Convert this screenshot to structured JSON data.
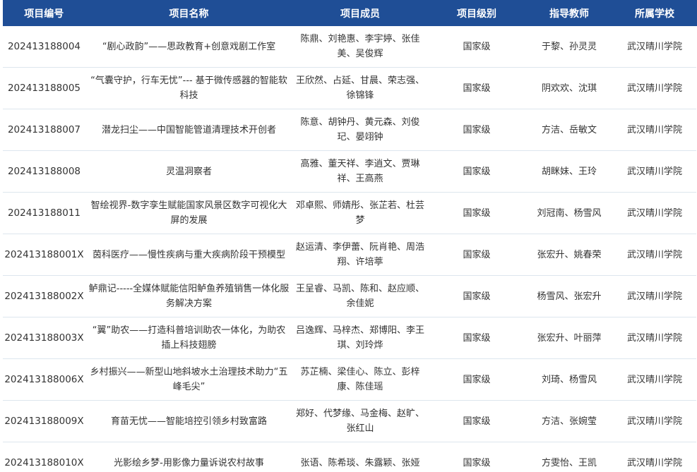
{
  "table": {
    "headers": [
      "项目编号",
      "项目名称",
      "项目成员",
      "项目级别",
      "指导教师",
      "所属学校"
    ],
    "rows": [
      {
        "id": "202413188004",
        "name": "“剧心政韵”——思政教育+创意戏剧工作室",
        "members": "陈鼎、刘艳惠、李宇婷、张佳美、吴俊辉",
        "level": "国家级",
        "teacher": "于黎、孙灵灵",
        "school": "武汉晴川学院"
      },
      {
        "id": "202413188005",
        "name": "“气囊守护，行车无忧”--- 基于微传感器的智能软科技",
        "members": "王欣然、占延、甘晨、荣志强、徐锦锋",
        "level": "国家级",
        "teacher": "阴欢欢、沈琪",
        "school": "武汉晴川学院"
      },
      {
        "id": "202413188007",
        "name": "潜龙扫尘——中国智能管道清理技术开创者",
        "members": "陈意、胡钟丹、黄元森、刘俊玘、晏翊钟",
        "level": "国家级",
        "teacher": "方洁、岳敏文",
        "school": "武汉晴川学院"
      },
      {
        "id": "202413188008",
        "name": "灵温洞察者",
        "members": "高雅、董天祥、李逍文、贾琳祥、王高燕",
        "level": "国家级",
        "teacher": "胡眯妹、王玲",
        "school": "武汉晴川学院"
      },
      {
        "id": "202413188011",
        "name": "智绘视界-数字孪生赋能国家风景区数字可视化大屏的发展",
        "members": "邓卓熙、师婧彤、张芷若、杜芸梦",
        "level": "国家级",
        "teacher": "刘冠南、杨雪风",
        "school": "武汉晴川学院"
      },
      {
        "id": "202413188001X",
        "name": "茵科医疗——慢性疾病与重大疾病阶段干预模型",
        "members": "赵运清、李伊蕾、阮肖艳、周浩翔、许培葶",
        "level": "国家级",
        "teacher": "张宏升、姚春荣",
        "school": "武汉晴川学院"
      },
      {
        "id": "202413188002X",
        "name": "鲈鼎记-----全媒体赋能信阳鲈鱼养殖销售一体化服务解决方案",
        "members": "王呈睿、马凯、陈和、赵应顺、余佳妮",
        "level": "国家级",
        "teacher": "杨雪风、张宏升",
        "school": "武汉晴川学院"
      },
      {
        "id": "202413188003X",
        "name": "“翼”助农——打造科普培训助农一体化，为助农插上科技翅膀",
        "members": "吕逸辉、马梓杰、郑博阳、李王琪、刘玲烨",
        "level": "国家级",
        "teacher": "张宏升、叶丽萍",
        "school": "武汉晴川学院"
      },
      {
        "id": "202413188006X",
        "name": "乡村振兴——新型山地斜坡水土治理技术助力“五峰毛尖”",
        "members": "苏芷楠、梁佳心、陈立、彭梓康、陈佳瑶",
        "level": "国家级",
        "teacher": "刘琦、杨雪风",
        "school": "武汉晴川学院"
      },
      {
        "id": "202413188009X",
        "name": "育苗无忧——智能培控引领乡村致富路",
        "members": "郑好、代梦缘、马金梅、赵旷、张红山",
        "level": "国家级",
        "teacher": "方洁、张婉莹",
        "school": "武汉晴川学院"
      },
      {
        "id": "202413188010X",
        "name": "光影绘乡梦-用影像力量诉说农村故事",
        "members": "张语、陈希琰、朱露颖、张娅",
        "level": "国家级",
        "teacher": "方雯怡、王凯",
        "school": "武汉晴川学院"
      }
    ]
  }
}
